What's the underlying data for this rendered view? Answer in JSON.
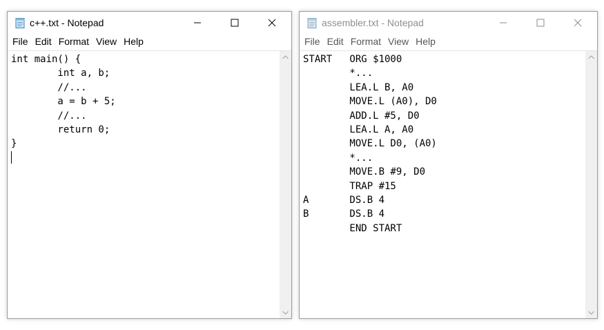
{
  "menu_labels": [
    "File",
    "Edit",
    "Format",
    "View",
    "Help"
  ],
  "windows": [
    {
      "title": "c++.txt - Notepad",
      "state": "active",
      "menu": [
        "File",
        "Edit",
        "Format",
        "View",
        "Help"
      ],
      "icon": "notepad-icon",
      "lines": [
        "int main() {",
        "        int a, b;",
        "        //...",
        "        a = b + 5;",
        "        //...",
        "        return 0;",
        "}",
        ""
      ]
    },
    {
      "title": "assembler.txt - Notepad",
      "state": "inactive",
      "menu": [
        "File",
        "Edit",
        "Format",
        "View",
        "Help"
      ],
      "icon": "notepad-icon",
      "lines": [
        "START   ORG $1000",
        "        *...",
        "        LEA.L B, A0",
        "        MOVE.L (A0), D0",
        "        ADD.L #5, D0",
        "        LEA.L A, A0",
        "        MOVE.L D0, (A0)",
        "        *...",
        "        MOVE.B #9, D0",
        "        TRAP #15",
        "A       DS.B 4",
        "B       DS.B 4",
        "        END START"
      ]
    }
  ],
  "controls": {
    "minimize": "minimize-icon",
    "maximize": "maximize-icon",
    "close": "close-icon"
  },
  "colors": {
    "title_active": "#000000",
    "title_inactive": "#8f8f8f",
    "scrollbar_track": "#f0f0f0",
    "window_border": "#9a9a9a"
  }
}
